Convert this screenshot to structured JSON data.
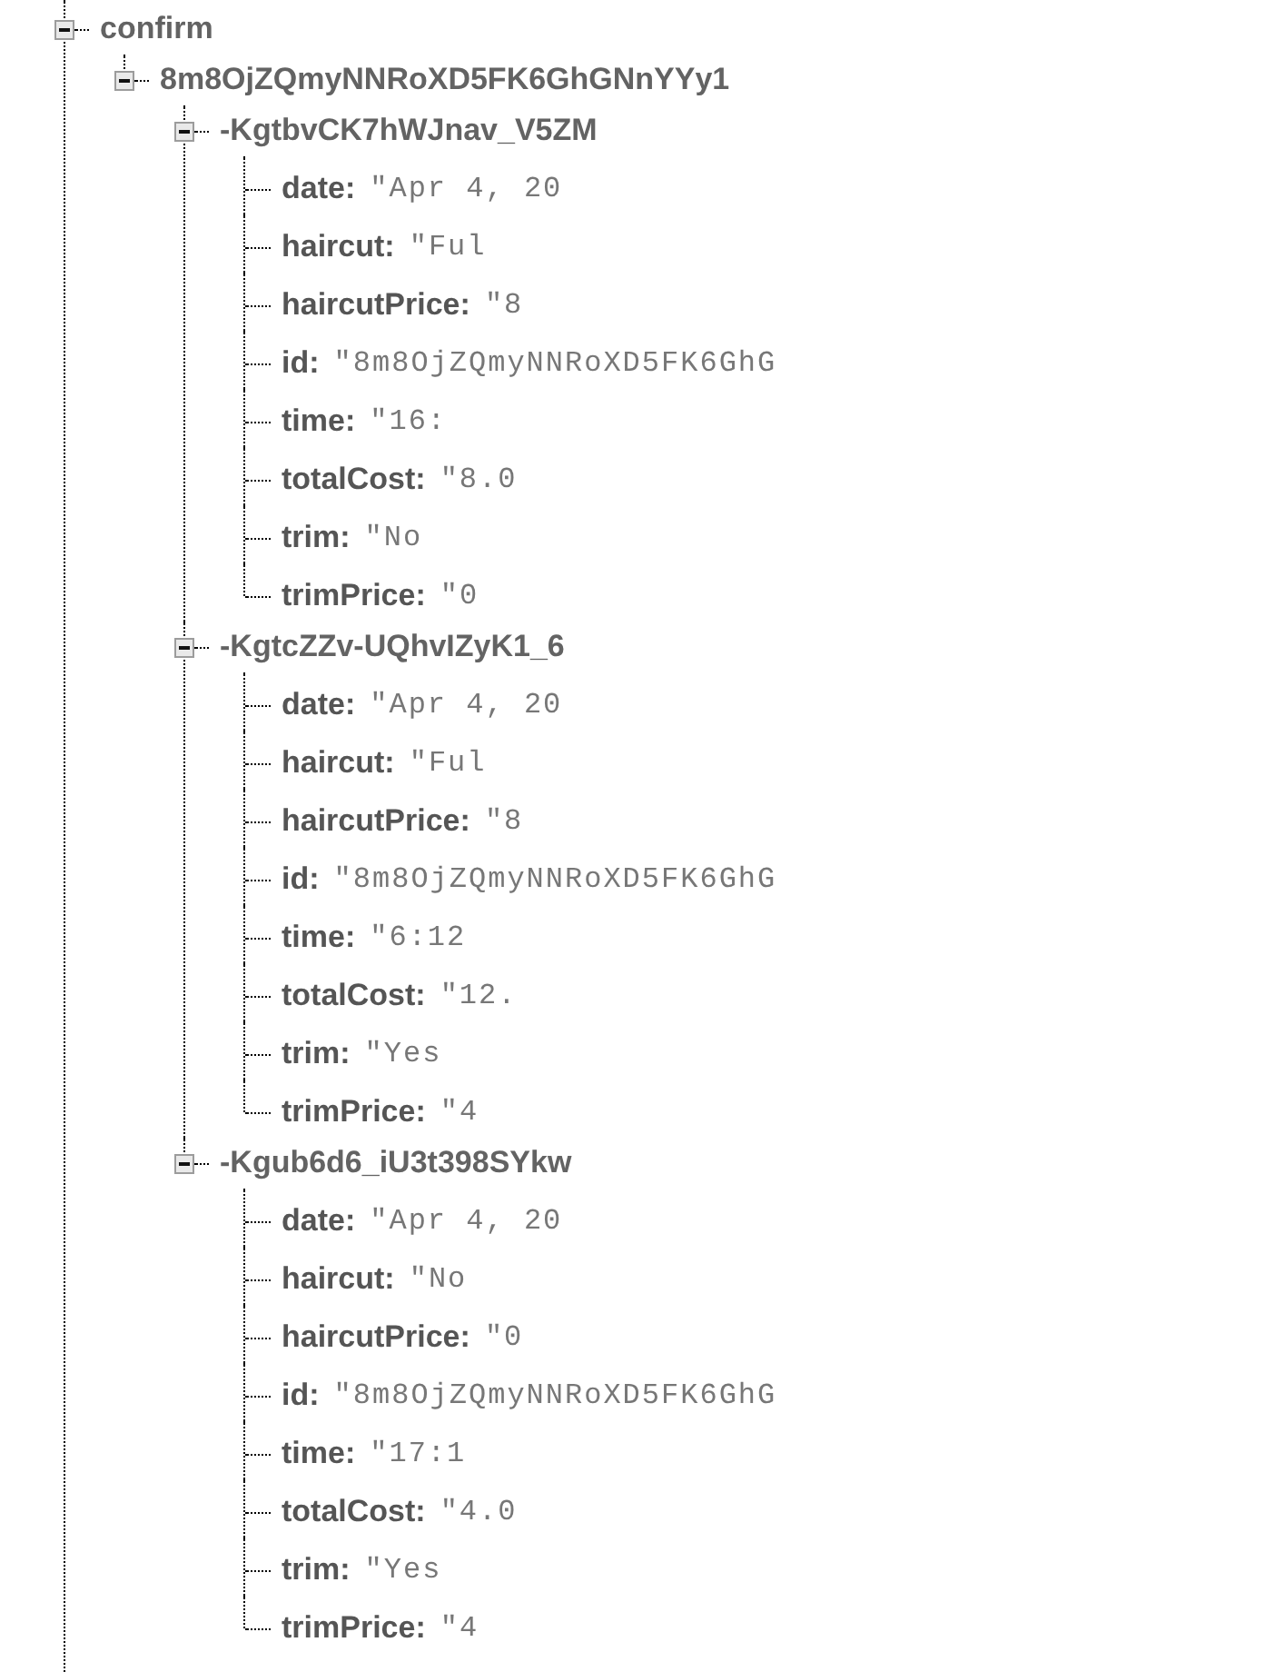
{
  "tree": [
    {
      "key": "confirm",
      "expanded": true,
      "children": [
        {
          "key": "8m8OjZQmyNNRoXD5FK6GhGNnYYy1",
          "expanded": true,
          "children": [
            {
              "key": "-KgtbvCK7hWJnav_V5ZM",
              "expanded": true,
              "children": [
                {
                  "key": "date:",
                  "value": "\"Apr 4, 20"
                },
                {
                  "key": "haircut:",
                  "value": "\"Ful"
                },
                {
                  "key": "haircutPrice:",
                  "value": "\"8"
                },
                {
                  "key": "id:",
                  "value": "\"8m8OjZQmyNNRoXD5FK6GhG"
                },
                {
                  "key": "time:",
                  "value": "\"16:"
                },
                {
                  "key": "totalCost:",
                  "value": "\"8.0"
                },
                {
                  "key": "trim:",
                  "value": "\"No"
                },
                {
                  "key": "trimPrice:",
                  "value": "\"0"
                }
              ]
            },
            {
              "key": "-KgtcZZv-UQhvIZyK1_6",
              "expanded": true,
              "children": [
                {
                  "key": "date:",
                  "value": "\"Apr 4, 20"
                },
                {
                  "key": "haircut:",
                  "value": "\"Ful"
                },
                {
                  "key": "haircutPrice:",
                  "value": "\"8"
                },
                {
                  "key": "id:",
                  "value": "\"8m8OjZQmyNNRoXD5FK6GhG"
                },
                {
                  "key": "time:",
                  "value": "\"6:12"
                },
                {
                  "key": "totalCost:",
                  "value": "\"12."
                },
                {
                  "key": "trim:",
                  "value": "\"Yes"
                },
                {
                  "key": "trimPrice:",
                  "value": "\"4"
                }
              ]
            },
            {
              "key": "-Kgub6d6_iU3t398SYkw",
              "expanded": true,
              "children": [
                {
                  "key": "date:",
                  "value": "\"Apr 4, 20"
                },
                {
                  "key": "haircut:",
                  "value": "\"No"
                },
                {
                  "key": "haircutPrice:",
                  "value": "\"0"
                },
                {
                  "key": "id:",
                  "value": "\"8m8OjZQmyNNRoXD5FK6GhG"
                },
                {
                  "key": "time:",
                  "value": "\"17:1"
                },
                {
                  "key": "totalCost:",
                  "value": "\"4.0"
                },
                {
                  "key": "trim:",
                  "value": "\"Yes"
                },
                {
                  "key": "trimPrice:",
                  "value": "\"4"
                }
              ]
            }
          ]
        }
      ]
    }
  ]
}
